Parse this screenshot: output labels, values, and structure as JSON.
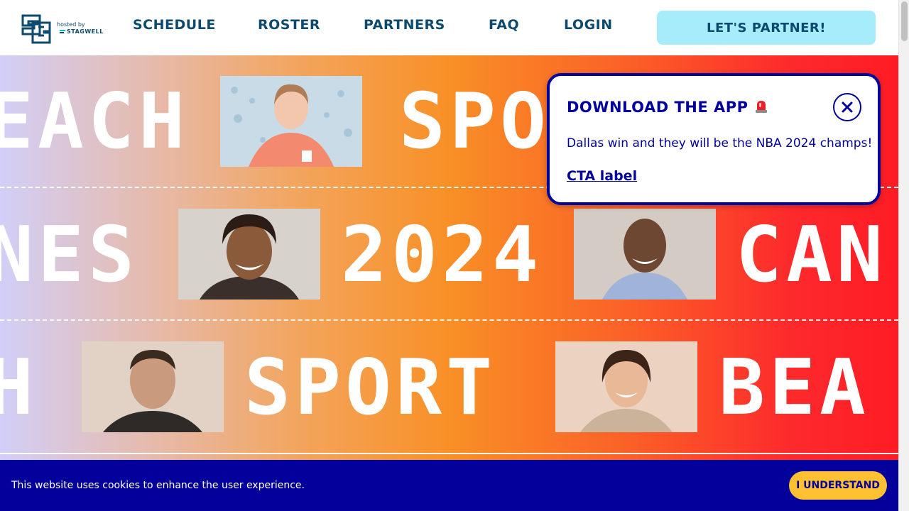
{
  "header": {
    "logo_hosted": "hosted by",
    "logo_brand": "STAGWELL",
    "nav": [
      "SCHEDULE",
      "ROSTER",
      "PARTNERS",
      "FAQ",
      "LOGIN"
    ],
    "cta_label": "LET'S PARTNER!"
  },
  "hero": {
    "row1": {
      "word_left": "EACH",
      "word_right": "SPORT"
    },
    "row2": {
      "word_left": "NES",
      "word_mid": "2024",
      "word_right": "CAN"
    },
    "row3": {
      "word_left": "H",
      "word_mid": "SPORT",
      "word_right": "BEA"
    }
  },
  "modal": {
    "title": "DOWNLOAD THE APP",
    "icon": "siren-icon",
    "body": "Dallas win and they will be the NBA 2024 champs!",
    "link": "CTA label",
    "close_icon": "close-icon"
  },
  "cookie": {
    "text": "This website uses cookies to enhance the user experience.",
    "button": "I UNDERSTAND"
  },
  "colors": {
    "navy": "#03009c",
    "header_text": "#0d4a6e",
    "cta_bg": "#a6ecfb",
    "cookie_button": "#fec132"
  }
}
